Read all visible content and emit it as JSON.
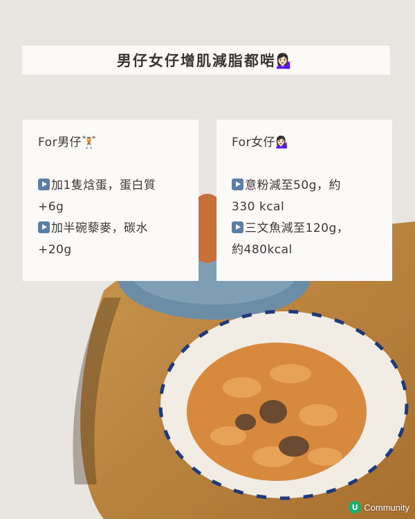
{
  "title": "男仔女仔增肌減脂都啱💁🏻‍♀️",
  "cards": {
    "men": {
      "heading": "For男仔🏋🏻",
      "lines": [
        "加1隻焓蛋，蛋白質",
        "+6g",
        "加半碗藜麥，碳水",
        "+20g"
      ]
    },
    "women": {
      "heading": "For女仔💁🏻‍♀️",
      "lines": [
        "意粉減至50g，約",
        "330 kcal",
        "三文魚減至120g，",
        "約480kcal"
      ]
    }
  },
  "brand": {
    "logo": "U",
    "name": "Community"
  },
  "icons": {
    "bullet": "play-icon"
  }
}
